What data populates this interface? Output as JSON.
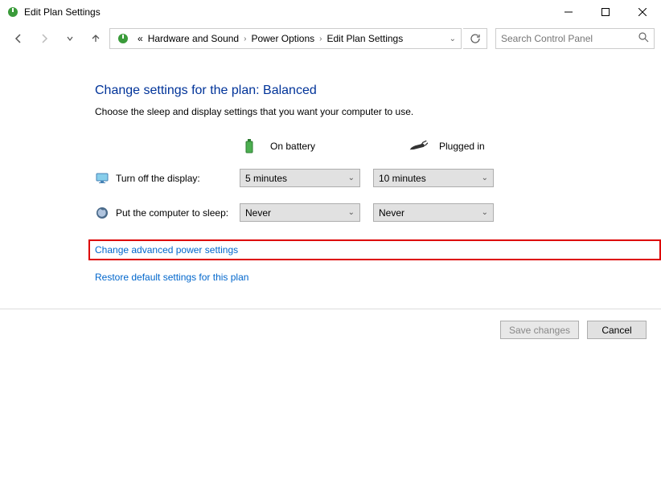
{
  "window": {
    "title": "Edit Plan Settings"
  },
  "breadcrumb": {
    "prefix": "«",
    "items": [
      "Hardware and Sound",
      "Power Options",
      "Edit Plan Settings"
    ]
  },
  "search": {
    "placeholder": "Search Control Panel"
  },
  "page": {
    "heading": "Change settings for the plan: Balanced",
    "subheading": "Choose the sleep and display settings that you want your computer to use."
  },
  "columns": {
    "battery": "On battery",
    "plugged": "Plugged in"
  },
  "settings": {
    "display": {
      "label": "Turn off the display:",
      "battery": "5 minutes",
      "plugged": "10 minutes"
    },
    "sleep": {
      "label": "Put the computer to sleep:",
      "battery": "Never",
      "plugged": "Never"
    }
  },
  "links": {
    "advanced": "Change advanced power settings",
    "restore": "Restore default settings for this plan"
  },
  "buttons": {
    "save": "Save changes",
    "cancel": "Cancel"
  }
}
